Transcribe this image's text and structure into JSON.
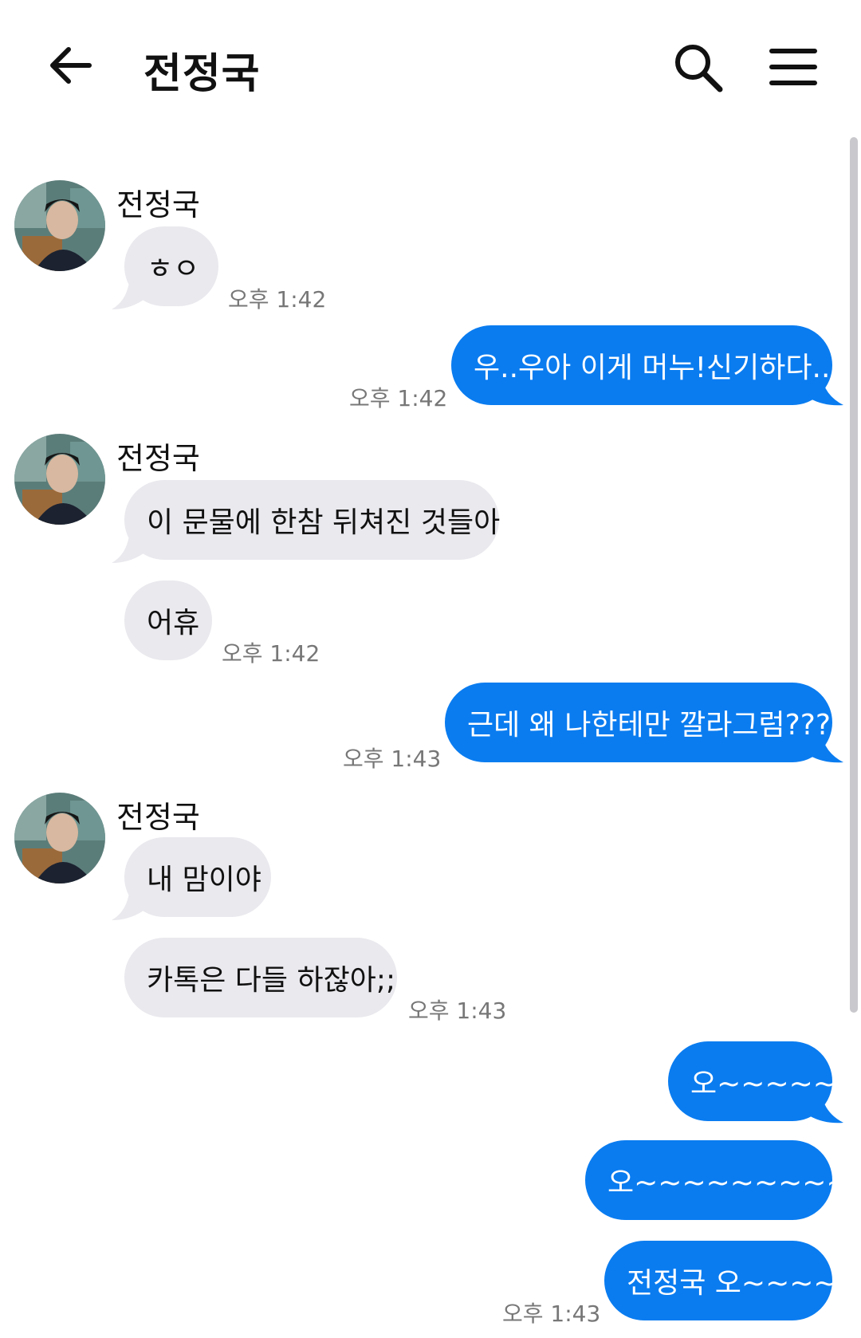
{
  "header": {
    "title": "전정국",
    "back_icon": "arrow-left-icon",
    "search_icon": "search-icon",
    "menu_icon": "hamburger-menu-icon"
  },
  "colors": {
    "incoming_bubble": "#e9e9ee",
    "outgoing_bubble": "#0a7cf0",
    "timestamp": "#777777"
  },
  "messages": [
    {
      "sender": "전정국",
      "text": "ㅎㅇ",
      "time": "오후 1:42"
    },
    {
      "text": "우..우아 이게 머누!신기하다..!",
      "time": "오후 1:42"
    },
    {
      "sender": "전정국",
      "text": "이 문물에 한참 뒤쳐진 것들아"
    },
    {
      "text": "어휴",
      "time": "오후 1:42"
    },
    {
      "text": "근데 왜 나한테만 깔라그럼???",
      "time": "오후 1:43"
    },
    {
      "sender": "전정국",
      "text": "내 맘이야"
    },
    {
      "text": "카톡은 다들 하잖아;;",
      "time": "오후 1:43"
    },
    {
      "text": "오~~~~~"
    },
    {
      "text": "오~~~~~~~~~~"
    },
    {
      "text": "전정국 오~~~~",
      "time": "오후 1:43"
    }
  ]
}
